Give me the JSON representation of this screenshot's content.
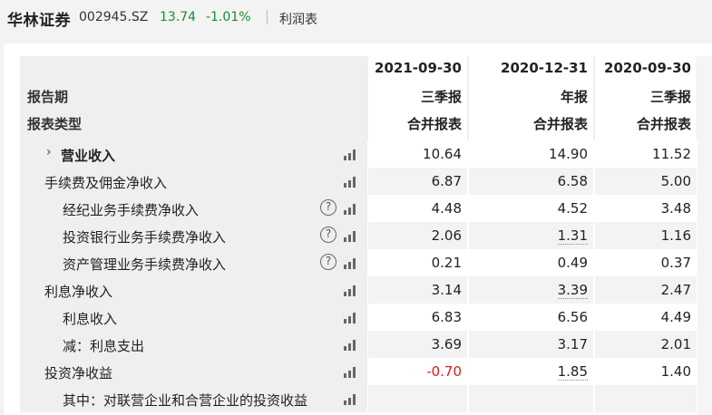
{
  "header": {
    "stock_name": "华林证券",
    "stock_code": "002945.SZ",
    "price": "13.74",
    "change": "-1.01%",
    "report_name": "利润表"
  },
  "table": {
    "row_label_period": "报告期",
    "row_label_type": "报表类型",
    "columns": [
      {
        "date": "2021-09-30",
        "period": "三季报",
        "type": "合并报表"
      },
      {
        "date": "2020-12-31",
        "period": "年报",
        "type": "合并报表"
      },
      {
        "date": "2020-09-30",
        "period": "三季报",
        "type": "合并报表"
      }
    ],
    "rows": [
      {
        "label": "营业收入",
        "values": [
          "10.64",
          "14.90",
          "11.52"
        ]
      },
      {
        "label": "手续费及佣金净收入",
        "values": [
          "6.87",
          "6.58",
          "5.00"
        ]
      },
      {
        "label": "经纪业务手续费净收入",
        "values": [
          "4.48",
          "4.52",
          "3.48"
        ]
      },
      {
        "label": "投资银行业务手续费净收入",
        "values": [
          "2.06",
          "1.31",
          "1.16"
        ]
      },
      {
        "label": "资产管理业务手续费净收入",
        "values": [
          "0.21",
          "0.49",
          "0.37"
        ]
      },
      {
        "label": "利息净收入",
        "values": [
          "3.14",
          "3.39",
          "2.47"
        ]
      },
      {
        "label": "利息收入",
        "values": [
          "6.83",
          "6.56",
          "4.49"
        ]
      },
      {
        "label": "减：利息支出",
        "values": [
          "3.69",
          "3.17",
          "2.01"
        ]
      },
      {
        "label": "投资净收益",
        "values": [
          "-0.70",
          "1.85",
          "1.40"
        ]
      },
      {
        "label": "其中：对联营企业和合营企业的投资收益",
        "values": [
          "",
          "",
          ""
        ]
      }
    ],
    "help_icon_glyph": "?",
    "expand_icon_glyph": "›"
  },
  "colors": {
    "price_color": "#1a8c2e",
    "negative_color": "#d21e1e"
  }
}
